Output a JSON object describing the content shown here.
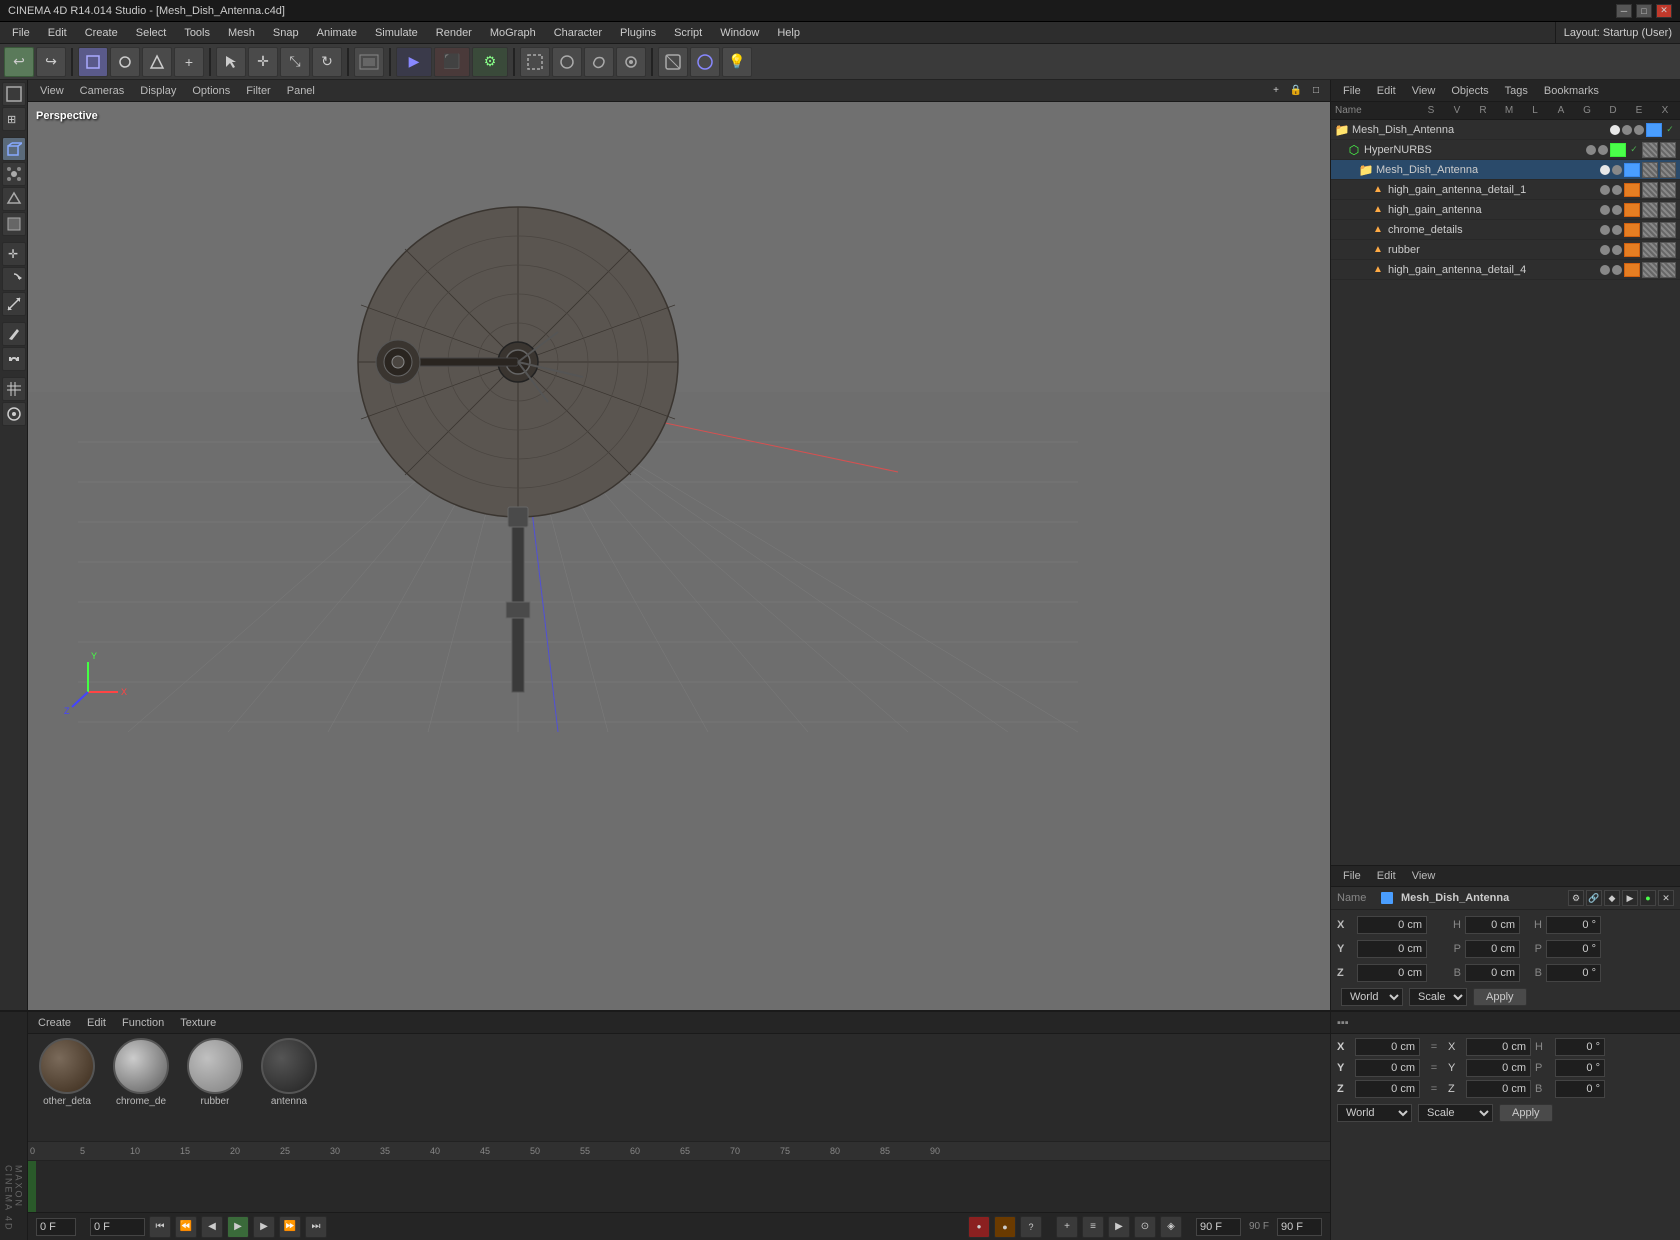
{
  "app": {
    "title": "CINEMA 4D R14.014 Studio - [Mesh_Dish_Antenna.c4d]",
    "layout_label": "Layout:",
    "layout_value": "Startup (User)"
  },
  "menubar": {
    "items": [
      "File",
      "Edit",
      "Create",
      "Select",
      "Tools",
      "Mesh",
      "Snap",
      "Animate",
      "Simulate",
      "Render",
      "MoGraph",
      "Character",
      "Plugins",
      "Script",
      "Window",
      "Help"
    ]
  },
  "toolbar": {
    "undo_label": "↩",
    "redo_label": "↪"
  },
  "viewport": {
    "view_label": "View",
    "cameras_label": "Cameras",
    "display_label": "Display",
    "options_label": "Options",
    "filter_label": "Filter",
    "panel_label": "Panel",
    "perspective_label": "Perspective"
  },
  "right_panel": {
    "file_label": "File",
    "edit_label": "Edit",
    "view_label": "View",
    "objects_label": "Objects",
    "tags_label": "Tags",
    "bookmarks_label": "Bookmarks",
    "col_name": "Name",
    "col_s": "S",
    "col_v": "V",
    "col_r": "R",
    "col_m": "M",
    "col_l": "L",
    "col_a": "A",
    "col_g": "G",
    "col_d": "D",
    "col_e": "E",
    "col_x": "X"
  },
  "objects": [
    {
      "id": "mesh_dish_antenna_root",
      "name": "Mesh_Dish_Antenna",
      "indent": 0,
      "icon": "📁",
      "icon_color": "#4a9eff",
      "has_dot": true,
      "is_selected": false
    },
    {
      "id": "hyper_nurbs",
      "name": "HyperNURBS",
      "indent": 12,
      "icon": "⬡",
      "icon_color": "#4aff4a",
      "has_dot": true,
      "is_selected": false
    },
    {
      "id": "mesh_dish_antenna",
      "name": "Mesh_Dish_Antenna",
      "indent": 24,
      "icon": "📁",
      "icon_color": "#4a9eff",
      "has_dot": true,
      "is_selected": true
    },
    {
      "id": "high_gain_detail_1",
      "name": "high_gain_antenna_detail_1",
      "indent": 36,
      "icon": "▲",
      "icon_color": "#ffaa44",
      "has_dot": true,
      "is_selected": false
    },
    {
      "id": "high_gain_antenna",
      "name": "high_gain_antenna",
      "indent": 36,
      "icon": "▲",
      "icon_color": "#ffaa44",
      "has_dot": true,
      "is_selected": false
    },
    {
      "id": "chrome_details",
      "name": "chrome_details",
      "indent": 36,
      "icon": "▲",
      "icon_color": "#ffaa44",
      "has_dot": true,
      "is_selected": false
    },
    {
      "id": "rubber",
      "name": "rubber",
      "indent": 36,
      "icon": "▲",
      "icon_color": "#ffaa44",
      "has_dot": true,
      "is_selected": false
    },
    {
      "id": "high_gain_detail_4",
      "name": "high_gain_antenna_detail_4",
      "indent": 36,
      "icon": "▲",
      "icon_color": "#ffaa44",
      "has_dot": true,
      "is_selected": false
    }
  ],
  "attr_panel": {
    "file_label": "File",
    "edit_label": "Edit",
    "view_label": "View",
    "selected_name": "Mesh_Dish_Antenna",
    "x_label": "X",
    "y_label": "Y",
    "z_label": "Z",
    "x_pos": "0 cm",
    "y_pos": "0 cm",
    "z_pos": "0 cm",
    "x_rot": "0 cm",
    "y_rot": "0 cm",
    "z_rot": "0 cm",
    "h_val": "0 °",
    "p_val": "0 °",
    "b_val": "0 °",
    "world_label": "World",
    "scale_label": "Scale",
    "apply_label": "Apply"
  },
  "timeline": {
    "create_label": "Create",
    "edit_label": "Edit",
    "function_label": "Function",
    "texture_label": "Texture",
    "frame_start": "0 F",
    "frame_end": "90 F",
    "current_frame": "0 F",
    "frame_count": "90 F",
    "frame_ticks": [
      "0",
      "5",
      "10",
      "15",
      "20",
      "25",
      "30",
      "35",
      "40",
      "45",
      "50",
      "55",
      "60",
      "65",
      "70",
      "75",
      "80",
      "85",
      "90"
    ],
    "fps": "90 F"
  },
  "materials": [
    {
      "id": "mat1",
      "name": "other_deta",
      "color_top": "#5a4a3a",
      "color_bot": "#3a3a3a"
    },
    {
      "id": "mat2",
      "name": "chrome_de",
      "color_top": "#9a9a9a",
      "color_bot": "#6a6a6a"
    },
    {
      "id": "mat3",
      "name": "rubber",
      "color_top": "#aaaaaa",
      "color_bot": "#888888"
    },
    {
      "id": "mat4",
      "name": "antenna",
      "color_top": "#444444",
      "color_bot": "#222222"
    }
  ],
  "playback": {
    "start_frame": "0 F",
    "current_frame": "0 F",
    "end_frame": "90 F",
    "fps_label": "90 F"
  }
}
